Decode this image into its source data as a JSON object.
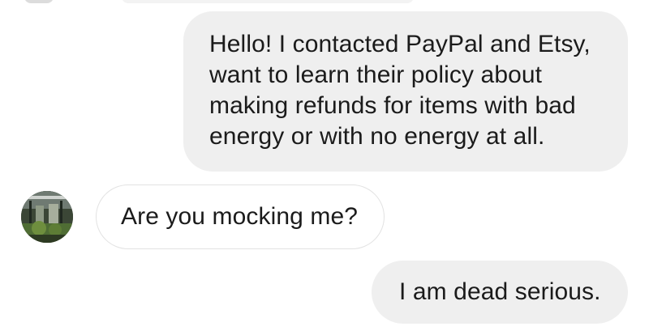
{
  "conversation": {
    "messages": [
      {
        "direction": "outgoing",
        "lines": [
          "Hello! I contacted PayPal and Etsy,",
          "want to learn their policy about",
          "making refunds for items with bad",
          "energy or with no energy at all."
        ]
      },
      {
        "direction": "incoming",
        "text": "Are you mocking me?"
      },
      {
        "direction": "outgoing",
        "text": "I am dead serious."
      }
    ]
  },
  "avatar": {
    "icon": "contact-avatar-photo"
  },
  "colors": {
    "outgoing_bubble": "#efefef",
    "incoming_bubble": "#ffffff",
    "incoming_border": "#e2e2e2",
    "text": "#1b1b1b",
    "background": "#ffffff"
  }
}
